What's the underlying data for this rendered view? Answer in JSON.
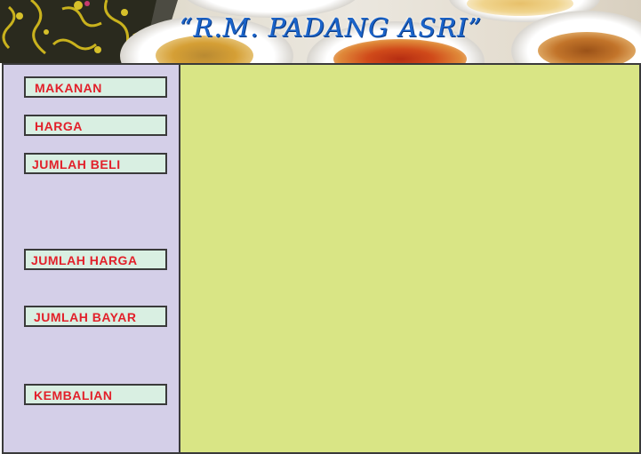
{
  "banner": {
    "title": "“R.M. PADANG ASRI”"
  },
  "form": {
    "labels": {
      "makanan": "MAKANAN",
      "harga": "HARGA",
      "jumlah_beli": "JUMLAH BELI",
      "jumlah_harga": "JUMLAH HARGA",
      "jumlah_bayar": "JUMLAH BAYAR",
      "kembalian": "KEMBALIAN"
    }
  },
  "colors": {
    "title_text": "#1a63c9",
    "label_text": "#e2202a",
    "label_background": "#d9efe2",
    "left_panel": "#d4cfe8",
    "right_panel": "#d9e585"
  }
}
